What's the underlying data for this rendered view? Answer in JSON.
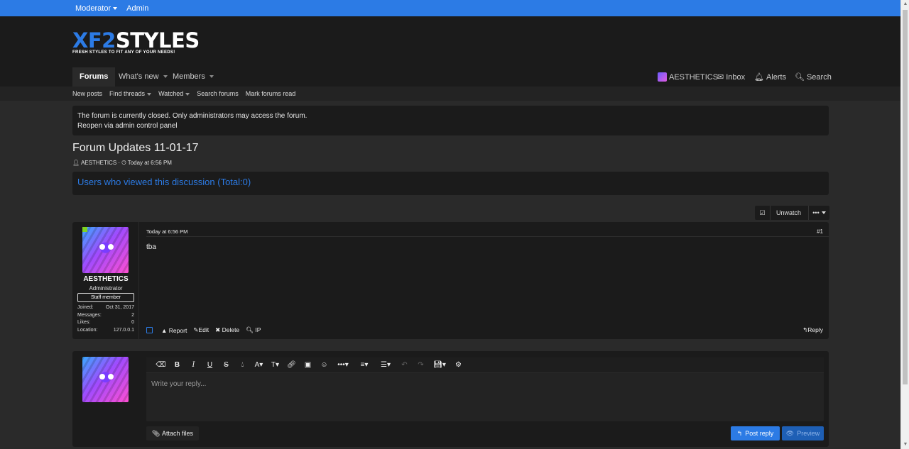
{
  "topbar": {
    "moderator": "Moderator",
    "admin": "Admin"
  },
  "logo": {
    "part1": "XF2",
    "part2": "STYLES",
    "tagline": "FRESH STYLES TO FIT ANY OF YOUR NEEDS!"
  },
  "nav": {
    "tabs": [
      {
        "label": "Forums"
      },
      {
        "label": "What's new"
      },
      {
        "label": "Members"
      }
    ],
    "user": "AESTHETICS",
    "inbox": "Inbox",
    "alerts": "Alerts",
    "search": "Search"
  },
  "subnav": {
    "items": [
      "New posts",
      "Find threads",
      "Watched",
      "Search forums",
      "Mark forums read"
    ]
  },
  "notice": {
    "line1": "The forum is currently closed. Only administrators may access the forum.",
    "line2": "Reopen via admin control panel"
  },
  "thread": {
    "title": "Forum Updates 11-01-17",
    "author": "AESTHETICS",
    "date": "Today at 6:56 PM"
  },
  "viewed": {
    "text": "Users who viewed this discussion (Total:0)"
  },
  "watch": {
    "label": "Unwatch"
  },
  "post": {
    "date": "Today at 6:56 PM",
    "number": "#1",
    "body": "tba",
    "user": {
      "name": "AESTHETICS",
      "title": "Administrator",
      "badge": "Staff member"
    },
    "stats": [
      {
        "label": "Joined:",
        "value": "Oct 31, 2017"
      },
      {
        "label": "Messages:",
        "value": "2"
      },
      {
        "label": "Likes:",
        "value": "0"
      },
      {
        "label": "Location:",
        "value": "127.0.0.1"
      }
    ],
    "actions": {
      "report": "Report",
      "edit": "Edit",
      "delete": "Delete",
      "ip": "IP",
      "reply": "Reply"
    }
  },
  "reply": {
    "placeholder": "Write your reply...",
    "attach": "Attach files",
    "post": "Post reply",
    "preview": "Preview"
  },
  "colors": {
    "accent": "#2c7be5",
    "bg": "#2a2a2a",
    "panel": "#1b1b1b"
  }
}
